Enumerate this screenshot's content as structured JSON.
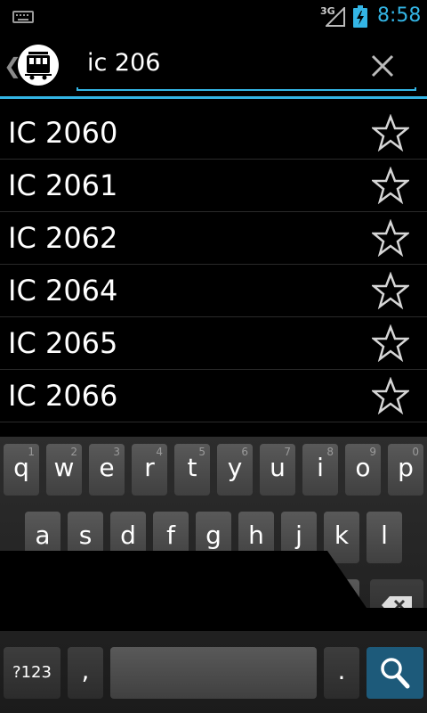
{
  "status_bar": {
    "network": "3G",
    "time": "8:58"
  },
  "search": {
    "query": "ic 206",
    "placeholder": ""
  },
  "results": [
    "IC 2060",
    "IC 2061",
    "IC 2062",
    "IC 2064",
    "IC 2065",
    "IC 2066"
  ],
  "keyboard": {
    "row1": [
      {
        "ch": "q",
        "hint": "1"
      },
      {
        "ch": "w",
        "hint": "2"
      },
      {
        "ch": "e",
        "hint": "3"
      },
      {
        "ch": "r",
        "hint": "4"
      },
      {
        "ch": "t",
        "hint": "5"
      },
      {
        "ch": "y",
        "hint": "6"
      },
      {
        "ch": "u",
        "hint": "7"
      },
      {
        "ch": "i",
        "hint": "8"
      },
      {
        "ch": "o",
        "hint": "9"
      },
      {
        "ch": "p",
        "hint": "0"
      }
    ],
    "row2": [
      "a",
      "s",
      "d",
      "f",
      "g",
      "h",
      "j",
      "k",
      "l"
    ],
    "symbols_label": "?123",
    "comma": ",",
    "period": "."
  },
  "colors": {
    "accent": "#33b5e5",
    "background": "#000000"
  }
}
